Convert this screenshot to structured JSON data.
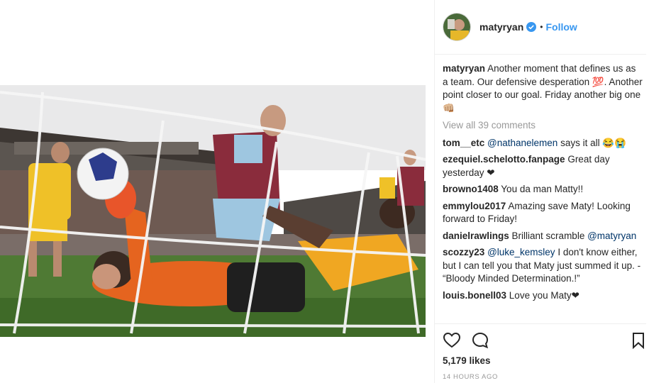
{
  "post": {
    "username": "matyryan",
    "follow_label": "Follow",
    "separator": "•"
  },
  "caption": {
    "username": "matyryan",
    "text": "Another moment that defines us as a team. Our defensive desperation 💯. Another point closer to our goal. Friday another big one 👊🏼"
  },
  "view_all_label": "View all 39 comments",
  "comments": [
    {
      "user": "tom__etc",
      "mention": "@nathanelemen",
      "text": " says it all 😂😭"
    },
    {
      "user": "ezequiel.schelotto.fanpage",
      "mention": "",
      "text": "Great day yesterday ❤"
    },
    {
      "user": "browno1408",
      "mention": "",
      "text": "You da man Matty!!"
    },
    {
      "user": "emmylou2017",
      "mention": "",
      "text": "Amazing save Maty! Looking forward to Friday!"
    },
    {
      "user": "danielrawlings",
      "mention": "",
      "text": "Brilliant scramble ",
      "mention_after": "@matyryan"
    },
    {
      "user": "scozzy23",
      "mention": "@luke_kemsley",
      "text": " I don't know either, but I can tell you that Maty just summed it up. - “Bloody Minded Determination.!”"
    },
    {
      "user": "louis.bonell03",
      "mention": "",
      "text": "Love you Maty❤"
    }
  ],
  "likes_label": "5,179 likes",
  "timestamp": "14 HOURS AGO",
  "icons": {
    "verified": "verified-badge-icon",
    "like": "heart-icon",
    "comment": "comment-bubble-icon",
    "save": "bookmark-icon"
  },
  "colors": {
    "link": "#3897f0",
    "mention": "#003569",
    "muted": "#999999",
    "border": "#efefef"
  }
}
